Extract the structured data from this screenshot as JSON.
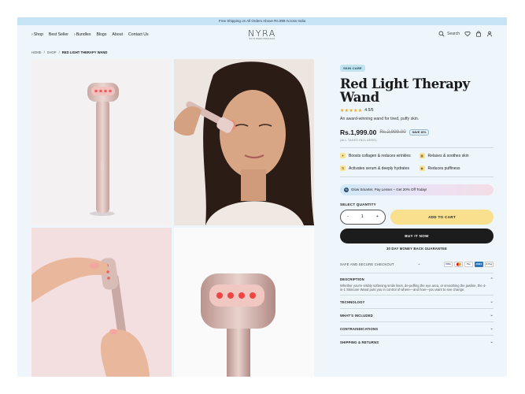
{
  "announcement": "Free Shipping on All Orders Above Rs.999 Across India",
  "nav": {
    "links": [
      {
        "label": "Shop",
        "has_dropdown": true
      },
      {
        "label": "Best Seller",
        "has_dropdown": false
      },
      {
        "label": "Bundles",
        "has_dropdown": true
      },
      {
        "label": "Blogs",
        "has_dropdown": false
      },
      {
        "label": "About",
        "has_dropdown": false
      },
      {
        "label": "Contact Us",
        "has_dropdown": false
      }
    ],
    "search_label": "Search",
    "dropdown_glyph": "›"
  },
  "logo": {
    "mark": "NYRA",
    "sub": "SKIN PERFORMANCE"
  },
  "breadcrumb": {
    "items": [
      "HOME",
      "SHOP",
      "RED LIGHT THERAPY WAND"
    ],
    "separator": "/"
  },
  "product": {
    "tag": "SKIN CARE",
    "title": "Red Light Therapy Wand",
    "stars": "★★★★★",
    "rating": "4.5/5",
    "tagline": "An award-winning wand for tired, puffy skin.",
    "price": "Rs.1,999.00",
    "mrp": "Rs.2,999.00",
    "save": "SAVE 10%",
    "taxes": "(ALL TAXES INCLUDED)",
    "benefits": [
      {
        "icon": "sparkle-icon",
        "glyph": "✦",
        "label": "Boosts collagen & reduces wrinkles"
      },
      {
        "icon": "relax-icon",
        "glyph": "▦",
        "label": "Relaxes & soothes skin"
      },
      {
        "icon": "serum-icon",
        "glyph": "⇅",
        "label": "Activates serum & deeply hydrates"
      },
      {
        "icon": "puffiness-icon",
        "glyph": "◉",
        "label": "Reduces puffiness"
      }
    ],
    "promo": "Glow Smarter, Pay Lesser – Get 20% Off Today!",
    "qty_label": "SELECT QUANTITY",
    "qty_value": "1",
    "qty_minus": "-",
    "qty_plus": "+",
    "add_to_cart": "ADD TO CART",
    "buy_now": "BUY IT NOW",
    "guarantee": "30 DAY MONEY BACK GUARANTEE",
    "secure_checkout": "SAFE AND SECURE CHECKOUT",
    "payments": [
      "VISA",
      "MC",
      "Pay",
      "AMEX",
      "G Pay"
    ]
  },
  "accordion": {
    "description_title": "DESCRIPTION",
    "description_body": "Whether you're visibly softening smile lines, de-puffing the eye area, or smoothing the jawline, the 4-in-1 Skincare Wand puts you in control of where—and how—you want to see change.",
    "items": [
      "TECHNOLOGY",
      "WHAT'S INCLUDED",
      "CONTRAINDICATIONS",
      "SHIPPING & RETURNS"
    ]
  },
  "colors": {
    "accent_yellow": "#f8e08e",
    "tag_blue": "#bfe3ef",
    "page_bg": "#eef6fc",
    "star": "#e6a817"
  }
}
